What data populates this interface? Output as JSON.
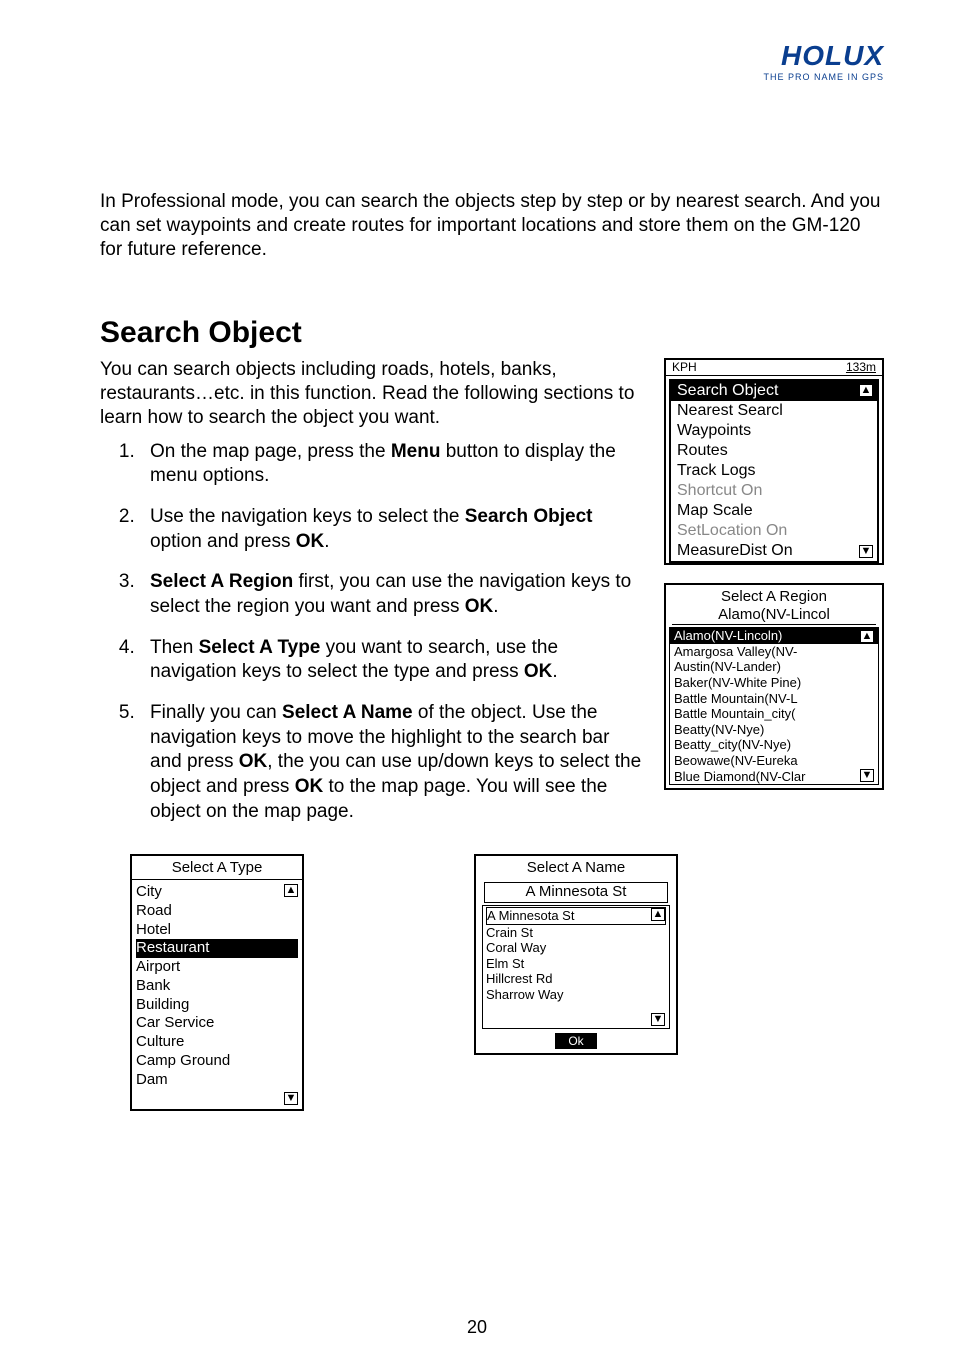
{
  "logo": {
    "brand": "HOLUX",
    "tagline": "THE PRO NAME IN GPS"
  },
  "intro": "In Professional mode, you can search the objects step by step or by nearest search. And you can set waypoints and create routes for important locations and store them on the GM-120 for future reference.",
  "heading": "Search Object",
  "description": "You can search objects including roads, hotels, banks, restaurants…etc. in this function. Read the following sections to learn how to search the object you want.",
  "steps": {
    "s1a": "On the map page, press the ",
    "s1b": "Menu",
    "s1c": " button to display the menu options.",
    "s2a": "Use the navigation keys to select the ",
    "s2b": "Search Object",
    "s2c": " option and press ",
    "s2d": "OK",
    "s2e": ".",
    "s3a": "Select A Region",
    "s3b": " first, you can use the navigation keys to select the region you want and press ",
    "s3c": "OK",
    "s3d": ".",
    "s4a": "Then ",
    "s4b": "Select A Type",
    "s4c": " you want to search, use the navigation keys to select the type and press ",
    "s4d": "OK",
    "s4e": ".",
    "s5a": "Finally you can ",
    "s5b": "Select A Name",
    "s5c": " of the object. Use the navigation keys to move the highlight to the search bar and press ",
    "s5d": "OK",
    "s5e": ", the you can use up/down keys to select the object and press ",
    "s5f": "OK",
    "s5g": " to the map page. You will see the object on the map page."
  },
  "gps_menu": {
    "topbar": {
      "left": "KPH",
      "right": "133m"
    },
    "items": [
      {
        "label": "Search Object",
        "state": "selected"
      },
      {
        "label": "Nearest Searcl",
        "state": "normal"
      },
      {
        "label": "Waypoints",
        "state": "normal"
      },
      {
        "label": "Routes",
        "state": "normal"
      },
      {
        "label": "Track Logs",
        "state": "normal"
      },
      {
        "label": "Shortcut On",
        "state": "disabled"
      },
      {
        "label": "Map Scale",
        "state": "normal"
      },
      {
        "label": "SetLocation On",
        "state": "disabled"
      },
      {
        "label": "MeasureDist On",
        "state": "normal"
      }
    ]
  },
  "region": {
    "title": "Select A Region",
    "subtitle": "Alamo(NV-Lincol",
    "items": [
      {
        "label": "Alamo(NV-Lincoln)",
        "selected": true
      },
      {
        "label": "Amargosa Valley(NV-"
      },
      {
        "label": "Austin(NV-Lander)"
      },
      {
        "label": "Baker(NV-White Pine)"
      },
      {
        "label": "Battle Mountain(NV-L"
      },
      {
        "label": "Battle Mountain_city("
      },
      {
        "label": "Beatty(NV-Nye)"
      },
      {
        "label": "Beatty_city(NV-Nye)"
      },
      {
        "label": "Beowawe(NV-Eureka"
      },
      {
        "label": "Blue Diamond(NV-Clar"
      }
    ]
  },
  "type_box": {
    "title": "Select A Type",
    "items": [
      {
        "label": "City"
      },
      {
        "label": "Road"
      },
      {
        "label": "Hotel"
      },
      {
        "label": "Restaurant",
        "selected": true
      },
      {
        "label": "Airport"
      },
      {
        "label": "Bank"
      },
      {
        "label": "Building"
      },
      {
        "label": "Car Service"
      },
      {
        "label": "Culture"
      },
      {
        "label": "Camp Ground"
      },
      {
        "label": "Dam"
      }
    ]
  },
  "name_box": {
    "title": "Select A Name",
    "input": "A  Minnesota  St",
    "items": [
      {
        "label": "A  Minnesota  St",
        "selected": true
      },
      {
        "label": "Crain  St"
      },
      {
        "label": "Coral  Way"
      },
      {
        "label": "Elm  St"
      },
      {
        "label": "Hillcrest  Rd"
      },
      {
        "label": "Sharrow  Way"
      }
    ],
    "ok": "Ok"
  },
  "page_number": "20"
}
